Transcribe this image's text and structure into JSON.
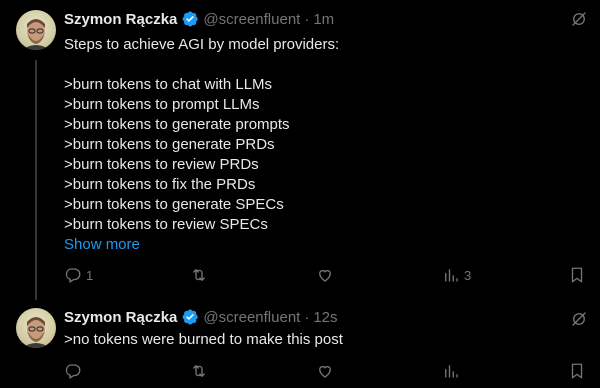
{
  "posts": [
    {
      "author": {
        "name": "Szymon Rączka",
        "handle": "@screenfluent"
      },
      "separator": "·",
      "time": "1m",
      "lines": [
        "Steps to achieve AGI by model providers:",
        "",
        ">burn tokens to chat with LLMs",
        ">burn tokens to prompt LLMs",
        ">burn tokens to generate prompts",
        ">burn tokens to generate PRDs",
        ">burn tokens to review PRDs",
        ">burn tokens to fix the PRDs",
        ">burn tokens to generate SPECs",
        ">burn tokens to review SPECs"
      ],
      "show_more": "Show more",
      "actions": {
        "replies": "1",
        "reposts": "",
        "likes": "",
        "views": "3"
      }
    },
    {
      "author": {
        "name": "Szymon Rączka",
        "handle": "@screenfluent"
      },
      "separator": "·",
      "time": "12s",
      "lines": [
        ">no tokens were burned to make this post"
      ],
      "actions": {
        "replies": "",
        "reposts": "",
        "likes": "",
        "views": ""
      }
    }
  ],
  "icons": {
    "verified": "verified-badge-icon",
    "grok": "grok-icon",
    "reply": "reply-icon",
    "repost": "repost-icon",
    "like": "heart-icon",
    "views": "views-icon",
    "bookmark": "bookmark-icon"
  },
  "colors": {
    "background": "#000000",
    "text": "#e7e9ea",
    "muted": "#71767b",
    "accent": "#1d9bf0",
    "thread_line": "#333639"
  }
}
